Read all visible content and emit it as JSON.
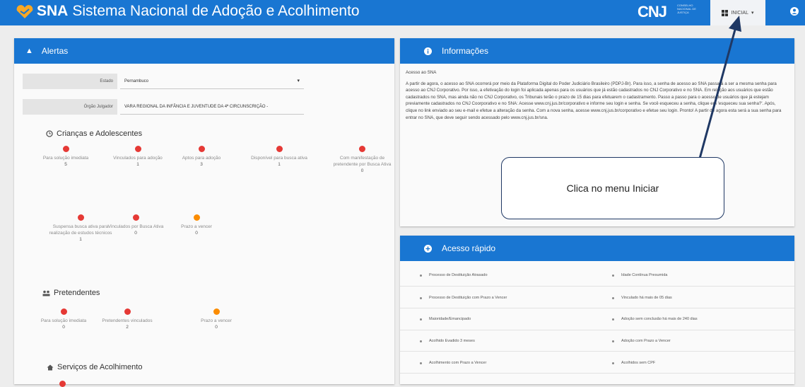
{
  "header": {
    "app_short": "SNA",
    "app_name": "Sistema Nacional de Adoção e Acolhimento",
    "cnj_logo_text": "CNJ",
    "cnj_logo_sub": "CONSELHO NACIONAL DE JUSTIÇA",
    "inicial_label": "INICIAL",
    "colors": {
      "primary": "#1976d2",
      "accent_logo": "#f9a825"
    }
  },
  "alertas": {
    "title": "Alertas",
    "estado_label": "Estado",
    "estado_value": "Pernambuco",
    "orgao_label": "Órgão Julgador",
    "orgao_value": "VARA REGIONAL DA INFÂNCIA E JUVENTUDE DA 4ª CIRCUNSCRIÇÃO -",
    "criancas": {
      "title": "Crianças e Adolescentes",
      "metrics": [
        {
          "label": "Para solução imediata",
          "value": "5",
          "color": "red"
        },
        {
          "label": "Vinculados para adoção",
          "value": "1",
          "color": "red"
        },
        {
          "label": "Aptos para adoção",
          "value": "3",
          "color": "red"
        },
        {
          "label": "Disponível para busca ativa",
          "value": "1",
          "color": "red"
        },
        {
          "label": "Com manifestação de pretendente por Busca Ativa",
          "value": "0",
          "color": "red"
        },
        {
          "label": "Suspensa busca ativa para realização de estudos técnicos",
          "value": "1",
          "color": "red"
        },
        {
          "label": "Vinculados por Busca Ativa",
          "value": "0",
          "color": "red"
        },
        {
          "label": "Prazo a vencer",
          "value": "0",
          "color": "orange"
        }
      ]
    },
    "pretendentes": {
      "title": "Pretendentes",
      "metrics": [
        {
          "label": "Para solução imediata",
          "value": "0",
          "color": "red"
        },
        {
          "label": "Pretendentes vinculados",
          "value": "2",
          "color": "red"
        },
        {
          "label": "Prazo a vencer",
          "value": "0",
          "color": "orange"
        }
      ]
    },
    "servicos": {
      "title": "Serviços de Acolhimento"
    }
  },
  "informacoes": {
    "title": "Informações",
    "subtitle": "Acesso ao SNA",
    "body": "A partir de agora, o acesso ao SNA ocorrerá por meio da Plataforma Digital do Poder Judiciário Brasileiro (PDPJ-Br). Para isso, a senha de acesso ao SNA passará a ser a mesma senha para acesso ao CNJ Corporativo. Por isso, a efetivação do login foi aplicada apenas para os usuários que já estão cadastrados no CNJ Corporativo e no SNA. Em relação aos usuários que estão cadastrados no SNA, mas ainda não no CNJ Corporativo, os Tribunais terão o prazo de 15 dias para efetuarem o cadastramento. Passo a passo para o acesso de usuários que já estejam previamente cadastrados no CNJ Coorporativo e no SNA: Acesse www.cnj.jus.br/corporativo e informe seu login e senha. Se você esqueceu a senha, clique em 'esqueceu sua senha?'. Após, clique no link enviado ao seu e-mail e efetue a alteração da senha. Com a nova senha, acesse www.cnj.jus.br/corporativo e efetue seu login. Pronto! A partir de agora esta será a sua senha para entrar no SNA, que deve seguir sendo acessado pelo www.cnj.jus.br/sna."
  },
  "acesso_rapido": {
    "title": "Acesso rápido",
    "left": [
      "Processo de Destituição Atrasado",
      "Processo de Destituição com Prazo a Vencer",
      "Maioridade/Emancipado",
      "Acolhido Evadido 3 meses",
      "Acolhimento com Prazo a Vencer"
    ],
    "right": [
      "Idade Contínua Presumida",
      "Vinculado há mais de 05 dias",
      "Adoção sem conclusão há mais de 240 dias",
      "Adoção com Prazo a Vencer",
      "Acolhidos sem CPF"
    ]
  },
  "annotation": {
    "callout_text": "Clica no menu Iniciar",
    "arrow_color": "#1f3864"
  }
}
